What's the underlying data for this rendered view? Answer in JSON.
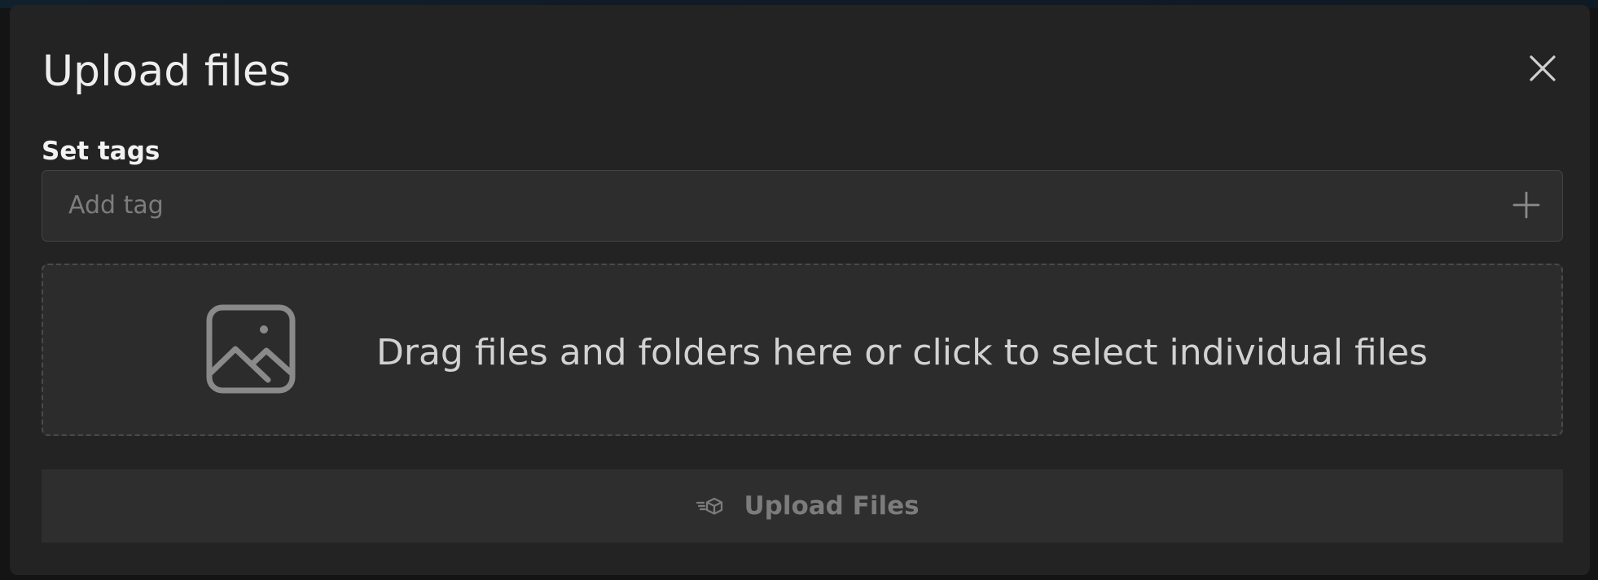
{
  "modal": {
    "title": "Upload files",
    "close_icon": "close-icon"
  },
  "tags": {
    "label": "Set tags",
    "input_value": "",
    "placeholder": "Add tag",
    "add_icon": "plus-icon"
  },
  "dropzone": {
    "icon": "image-icon",
    "text": "Drag files and folders here or click to select individual files"
  },
  "upload_button": {
    "icon": "fast-box-icon",
    "label": "Upload Files"
  },
  "colors": {
    "modal_background": "#232323",
    "input_background": "#2d2d2d",
    "dropzone_background": "#2c2c2c",
    "button_background": "#2e2e2e",
    "text_primary": "#eeeeee",
    "text_muted": "#7c7c7c"
  }
}
